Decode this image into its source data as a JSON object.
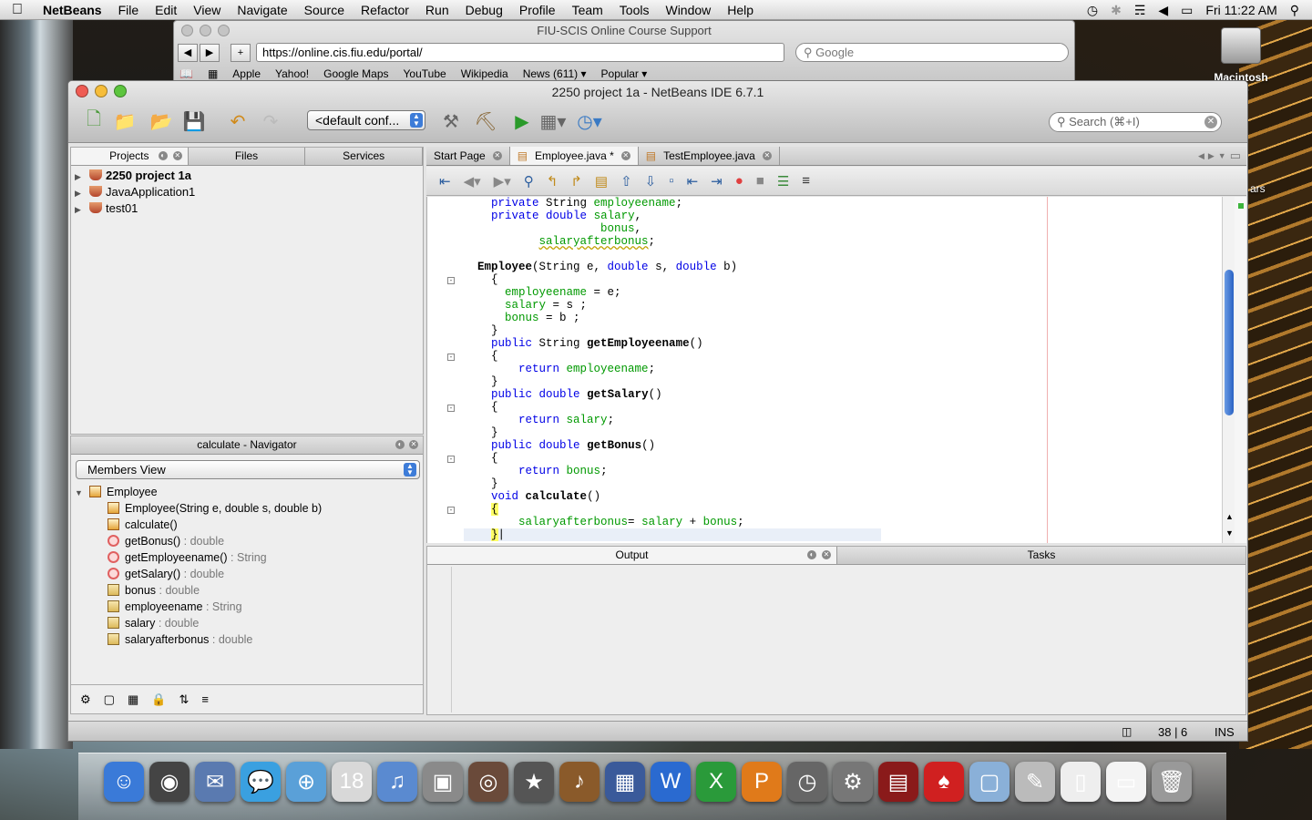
{
  "menubar": {
    "app": "NetBeans",
    "items": [
      "File",
      "Edit",
      "View",
      "Navigate",
      "Source",
      "Refactor",
      "Run",
      "Debug",
      "Profile",
      "Team",
      "Tools",
      "Window",
      "Help"
    ],
    "clock": "Fri 11:22 AM"
  },
  "browser": {
    "title": "FIU-SCIS Online Course Support",
    "url": "https://online.cis.fiu.edu/portal/",
    "search_placeholder": "Google",
    "bookmarks": [
      "Apple",
      "Yahoo!",
      "Google Maps",
      "YouTube",
      "Wikipedia",
      "News (611) ▾",
      "Popular ▾"
    ]
  },
  "desktop": {
    "hdd_label": "Macintosh HD",
    "partial_label": "ars"
  },
  "netbeans": {
    "title": "2250 project 1a - NetBeans IDE 6.7.1",
    "config": "<default conf...",
    "search_placeholder": "Search (⌘+I)",
    "left_tabs": [
      "Projects",
      "Files",
      "Services"
    ],
    "projects": [
      {
        "name": "2250 project 1a",
        "bold": true
      },
      {
        "name": "JavaApplication1",
        "bold": false
      },
      {
        "name": "test01",
        "bold": false
      }
    ],
    "navigator": {
      "title": "calculate - Navigator",
      "view": "Members View",
      "class": "Employee",
      "members": [
        {
          "name": "Employee(",
          "type": "String e, double s, double b)",
          "kind": "cons",
          "sep": ""
        },
        {
          "name": "calculate()",
          "type": "",
          "kind": "cons",
          "sep": ""
        },
        {
          "name": "getBonus()",
          "type": "double",
          "kind": "method",
          "sep": " : "
        },
        {
          "name": "getEmployeename()",
          "type": "String",
          "kind": "method",
          "sep": " : "
        },
        {
          "name": "getSalary()",
          "type": "double",
          "kind": "method",
          "sep": " : "
        },
        {
          "name": "bonus",
          "type": "double",
          "kind": "field",
          "sep": " : "
        },
        {
          "name": "employeename",
          "type": "String",
          "kind": "field",
          "sep": " : "
        },
        {
          "name": "salary",
          "type": "double",
          "kind": "field",
          "sep": " : "
        },
        {
          "name": "salaryafterbonus",
          "type": "double",
          "kind": "field",
          "sep": " : "
        }
      ]
    },
    "editor_tabs": [
      "Start Page",
      "Employee.java *",
      "TestEmployee.java"
    ],
    "output_tabs": [
      "Output",
      "Tasks"
    ],
    "status": {
      "position": "38 | 6",
      "mode": "INS"
    }
  },
  "colors": {
    "keyword": "#0000e6",
    "field": "#009900",
    "selection_blue": "#3d7cd8"
  },
  "dock_icons": [
    "finder-icon",
    "dashboard-icon",
    "mail-icon",
    "ichat-icon",
    "safari-icon",
    "ical-icon",
    "itunes-icon",
    "iphoto-icon",
    "photo-booth-icon",
    "imovie-icon",
    "garageband-icon",
    "spaces-icon",
    "word-icon",
    "excel-icon",
    "powerpoint-icon",
    "time-machine-icon",
    "system-preferences-icon",
    "filmstrip-icon",
    "poker-icon",
    "box-icon",
    "textedit-icon",
    "rtf-document-icon",
    "document-icon",
    "trash-icon"
  ]
}
